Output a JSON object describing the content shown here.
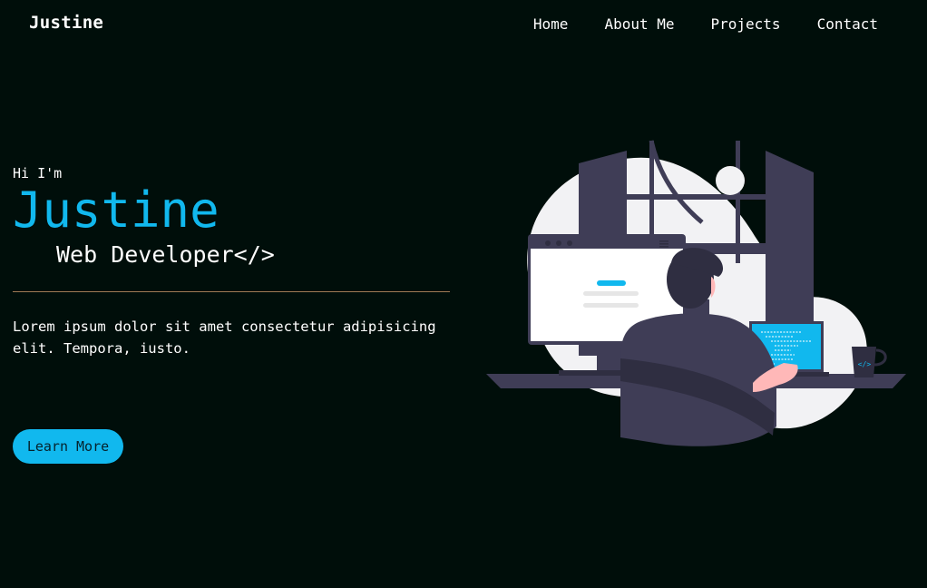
{
  "header": {
    "logo": "Justine",
    "nav": [
      {
        "label": "Home"
      },
      {
        "label": "About Me"
      },
      {
        "label": "Projects"
      },
      {
        "label": "Contact"
      }
    ]
  },
  "hero": {
    "greeting": "Hi I'm",
    "name": "Justine",
    "role": "Web Developer</>",
    "description": "Lorem ipsum dolor sit amet consectetur adipisicing elit. Tempora, iusto.",
    "cta_label": "Learn More"
  },
  "colors": {
    "background": "#000e0a",
    "accent": "#11b8ee",
    "divider": "#a07a55"
  },
  "illustration": {
    "mug_icon": "code-brackets-icon",
    "mug_glyph": "</>"
  }
}
